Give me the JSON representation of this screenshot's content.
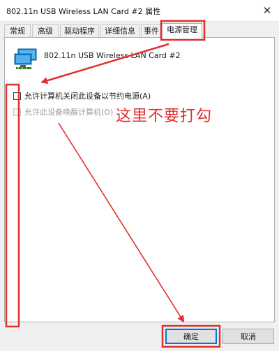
{
  "window": {
    "title": "802.11n USB Wireless LAN Card #2 属性",
    "close_glyph": "✕"
  },
  "tabs": [
    {
      "label": "常规",
      "active": false
    },
    {
      "label": "高级",
      "active": false
    },
    {
      "label": "驱动程序",
      "active": false
    },
    {
      "label": "详细信息",
      "active": false
    },
    {
      "label": "事件",
      "active": false
    },
    {
      "label": "电源管理",
      "active": true
    }
  ],
  "device": {
    "name": "802.11n USB Wireless LAN Card #2",
    "icon": "network-adapter-icon"
  },
  "options": [
    {
      "label": "允许计算机关闭此设备以节约电源(A)",
      "checked": false,
      "enabled": true
    },
    {
      "label": "允许此设备唤醒计算机(O)",
      "checked": false,
      "enabled": false
    }
  ],
  "annotation": {
    "text": "这里不要打勾",
    "color": "#e0302e"
  },
  "buttons": {
    "ok_label": "确定",
    "cancel_label": "取消"
  },
  "colors": {
    "accent": "#0078d7",
    "highlight": "#e0302e"
  }
}
